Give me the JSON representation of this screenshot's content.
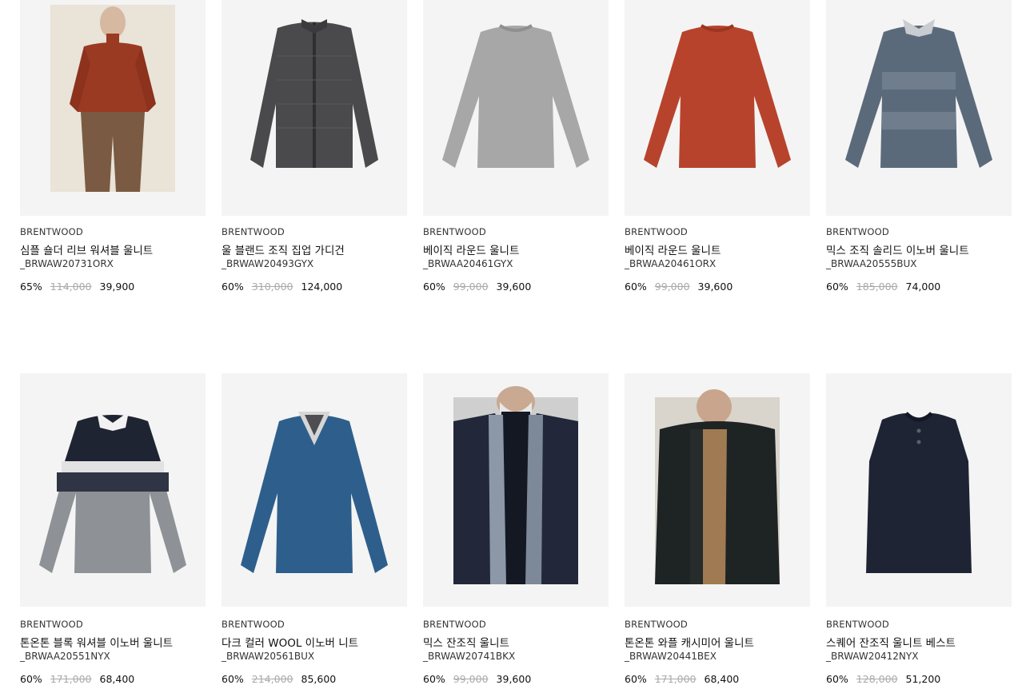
{
  "products": [
    {
      "brand": "BRENTWOOD",
      "name": "심플 숄더 리브 워셔블 울니트",
      "code": "_BRWAW20731ORX",
      "discount": "65%",
      "original_price": "114,000",
      "sale_price": "39,900",
      "image": "model-red-mockneck-knit",
      "color": "#9b3a22"
    },
    {
      "brand": "BRENTWOOD",
      "name": "울 블랜드 조직 집업 가디건",
      "code": "_BRWAW20493GYX",
      "discount": "60%",
      "original_price": "310,000",
      "sale_price": "124,000",
      "image": "charcoal-quilted-zip-cardigan",
      "color": "#4a4a4c"
    },
    {
      "brand": "BRENTWOOD",
      "name": "베이직 라운드 울니트",
      "code": "_BRWAA20461GYX",
      "discount": "60%",
      "original_price": "99,000",
      "sale_price": "39,600",
      "image": "grey-crewneck-knit",
      "color": "#a7a7a7"
    },
    {
      "brand": "BRENTWOOD",
      "name": "베이직 라운드 울니트",
      "code": "_BRWAA20461ORX",
      "discount": "60%",
      "original_price": "99,000",
      "sale_price": "39,600",
      "image": "orange-crewneck-knit",
      "color": "#b8432c"
    },
    {
      "brand": "BRENTWOOD",
      "name": "믹스 조직 솔리드 이노버 울니트",
      "code": "_BRWAA20555BUX",
      "discount": "60%",
      "original_price": "185,000",
      "sale_price": "74,000",
      "image": "blue-grey-layered-knit",
      "color": "#5b6a7b"
    },
    {
      "brand": "BRENTWOOD",
      "name": "톤온톤 블록 워셔블 이노버 울니트",
      "code": "_BRWAA20551NYX",
      "discount": "60%",
      "original_price": "171,000",
      "sale_price": "68,400",
      "image": "navy-stripe-block-knit",
      "color": "#2a3142"
    },
    {
      "brand": "BRENTWOOD",
      "name": "다크 컬러 WOOL 이노버 니트",
      "code": "_BRWAW20561BUX",
      "discount": "60%",
      "original_price": "214,000",
      "sale_price": "85,600",
      "image": "blue-vneck-layered-knit",
      "color": "#2e5f8c"
    },
    {
      "brand": "BRENTWOOD",
      "name": "믹스 잔조직 울니트",
      "code": "_BRWAW20741BKX",
      "discount": "60%",
      "original_price": "99,000",
      "sale_price": "39,600",
      "image": "model-coat-scarf",
      "color": "#22283a"
    },
    {
      "brand": "BRENTWOOD",
      "name": "톤온톤 와플 캐시미어 울니트",
      "code": "_BRWAW20441BEX",
      "discount": "60%",
      "original_price": "171,000",
      "sale_price": "68,400",
      "image": "model-black-padding",
      "color": "#1e2324"
    },
    {
      "brand": "BRENTWOOD",
      "name": "스퀘어 잔조직 울니트 베스트",
      "code": "_BRWAW20412NYX",
      "discount": "60%",
      "original_price": "128,000",
      "sale_price": "51,200",
      "image": "navy-knit-vest",
      "color": "#1f2434"
    }
  ]
}
